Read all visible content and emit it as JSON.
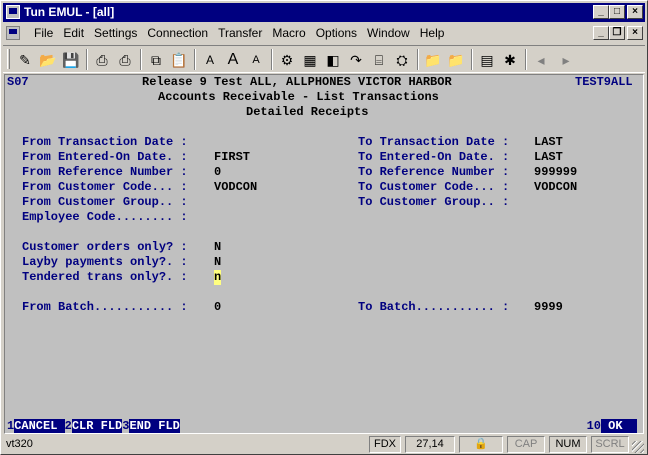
{
  "window": {
    "title": "Tun EMUL - [all]",
    "minimize_glyph": "_",
    "maximize_glyph": "□",
    "close_glyph": "×",
    "restore_glyph": "❐"
  },
  "menu": {
    "items": [
      "File",
      "Edit",
      "Settings",
      "Connection",
      "Transfer",
      "Macro",
      "Options",
      "Window",
      "Help"
    ]
  },
  "toolbar": {
    "icons": [
      "connect-icon",
      "open-icon",
      "save-icon",
      "print-icon",
      "print-setup-icon",
      "copy-icon",
      "paste-icon",
      "font-smaller-icon",
      "font-icon",
      "font-larger-icon",
      "color-icon",
      "keyboard-icon",
      "macro-icon",
      "hotspot-icon",
      "print-screen-icon",
      "config-icon",
      "folder-send-icon",
      "folder-receive-icon",
      "keypad-icon",
      "tools-icon",
      "back-icon",
      "forward-icon"
    ]
  },
  "terminal": {
    "screen_id": "S07",
    "header_line1": "Release 9 Test ALL, ALLPHONES VICTOR HARBOR",
    "program_id": "TEST9ALL",
    "header_line2": "Accounts Receivable - List Transactions",
    "header_line3": "Detailed Receipts",
    "from_fields": [
      {
        "label": "From Transaction Date :",
        "value": ""
      },
      {
        "label": "From Entered-On Date. :",
        "value": "FIRST"
      },
      {
        "label": "From Reference Number :",
        "value": "0"
      },
      {
        "label": "From Customer Code... :",
        "value": "VODCON"
      },
      {
        "label": "From Customer Group.. :",
        "value": ""
      },
      {
        "label": "Employee Code........ :",
        "value": ""
      }
    ],
    "to_fields": [
      {
        "label": "To Transaction Date :",
        "value": "LAST"
      },
      {
        "label": "To Entered-On Date. :",
        "value": "LAST"
      },
      {
        "label": "To Reference Number :",
        "value": "999999"
      },
      {
        "label": "To Customer Code... :",
        "value": "VODCON"
      },
      {
        "label": "To Customer Group.. :",
        "value": ""
      }
    ],
    "options": [
      {
        "label": "Customer orders only? :",
        "value": "N"
      },
      {
        "label": "Layby payments only?. :",
        "value": "N"
      },
      {
        "label": "Tendered trans only?. :",
        "value": "n"
      }
    ],
    "from_batch_label": "From Batch........... :",
    "from_batch_value": "0",
    "to_batch_label": "To Batch........... :",
    "to_batch_value": "9999"
  },
  "fkeys": [
    {
      "num": "1",
      "label": "CANCEL "
    },
    {
      "num": "2",
      "label": "CLR FLD"
    },
    {
      "num": "3",
      "label": "END FLD"
    }
  ],
  "okkey": {
    "num": "10",
    "label": " OK  "
  },
  "status": {
    "terminal_type": "vt320",
    "mode": "FDX",
    "cursor_pos": "27,14",
    "cap": "CAP",
    "num": "NUM",
    "scrl": "SCRL"
  }
}
